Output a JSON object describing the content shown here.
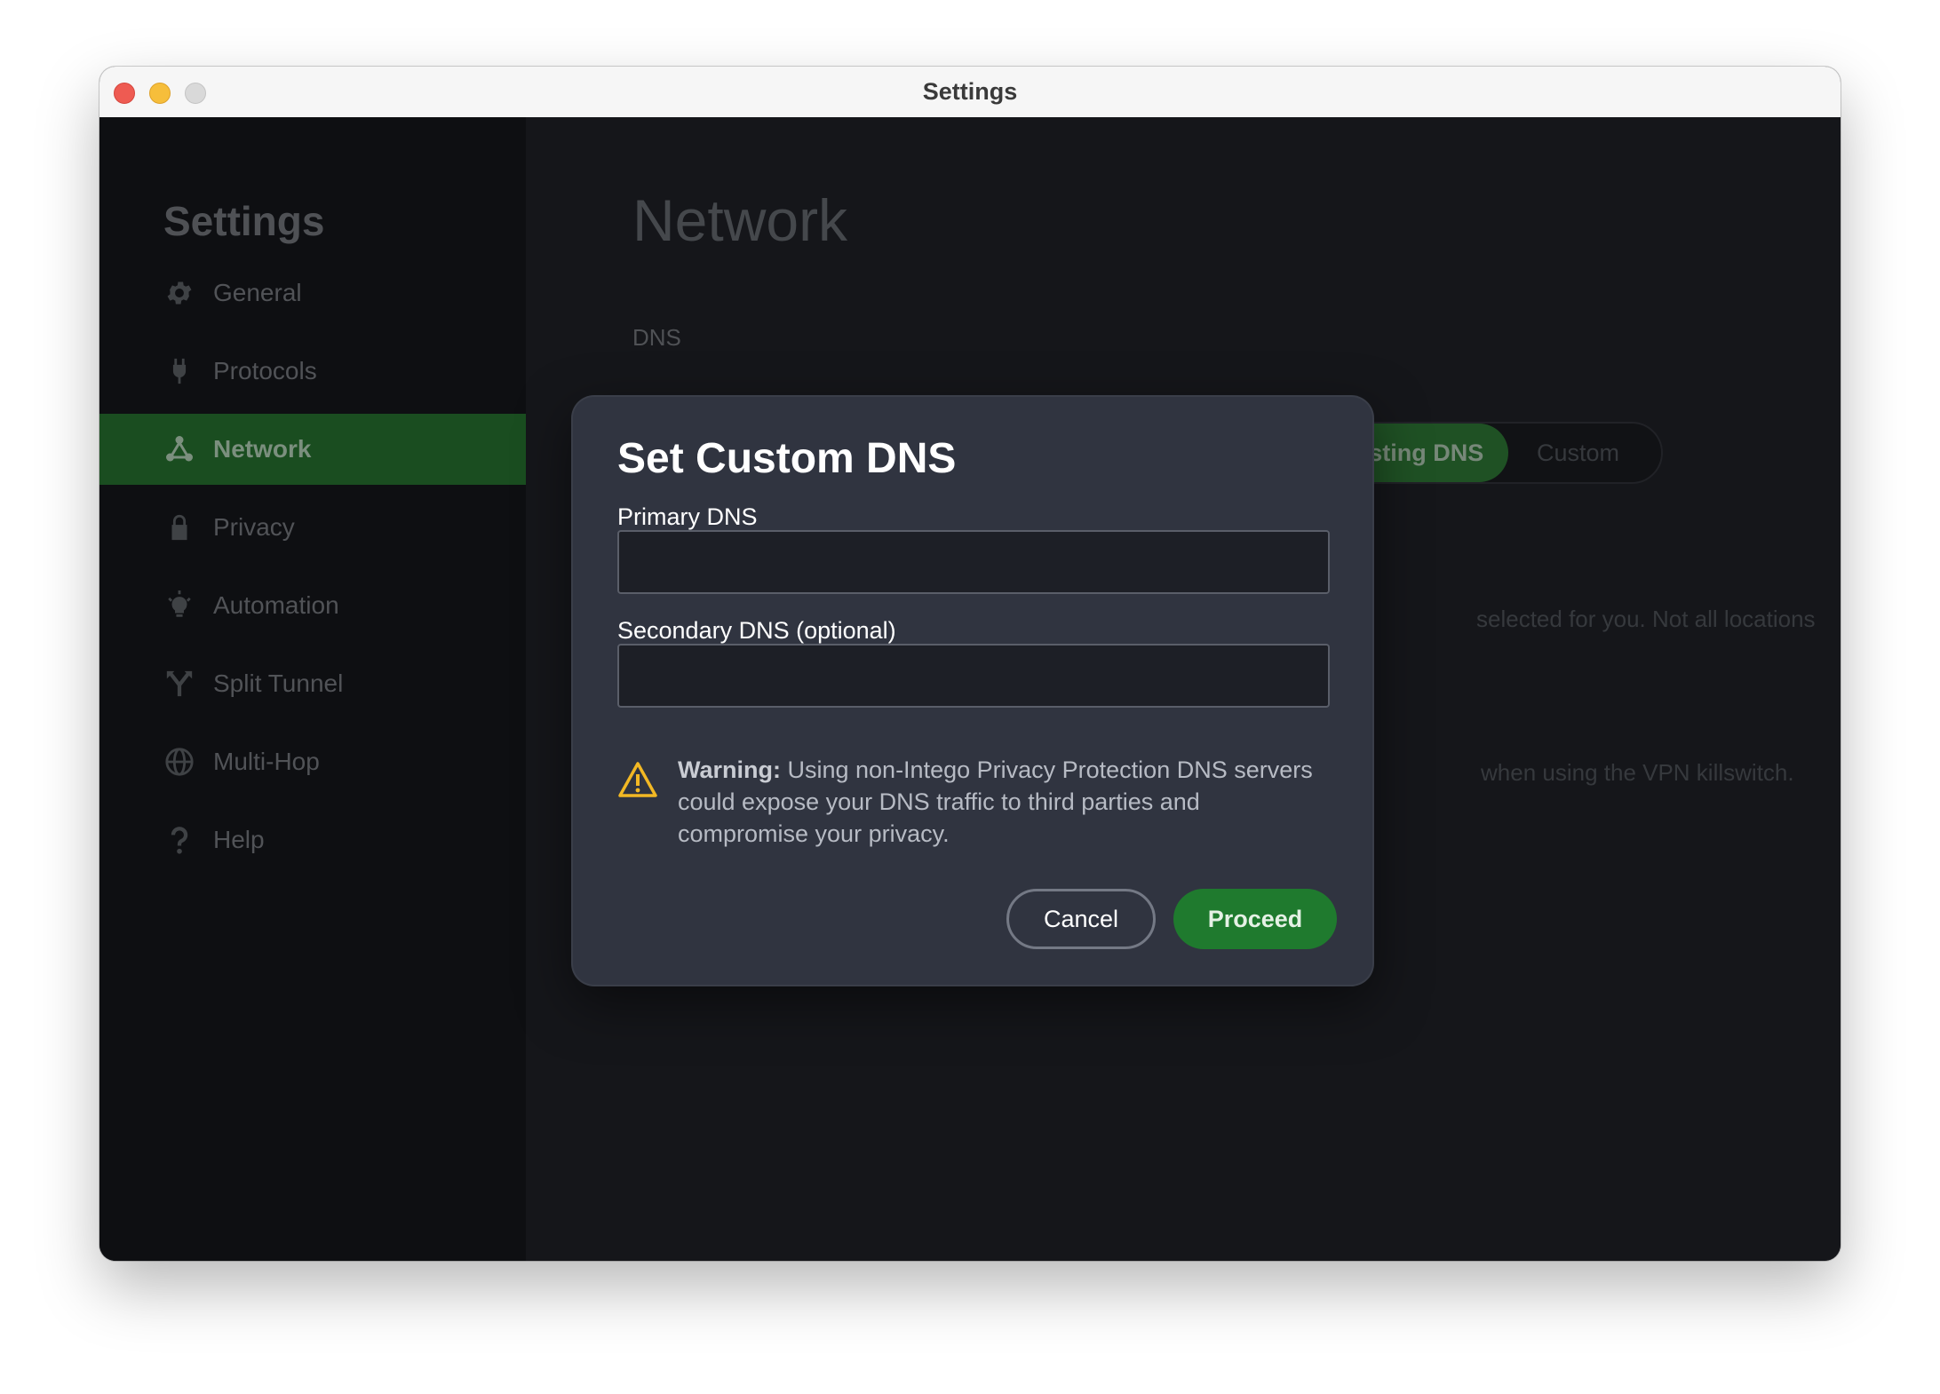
{
  "window": {
    "title": "Settings"
  },
  "sidebar": {
    "heading": "Settings",
    "items": [
      {
        "label": "General",
        "icon": "gear-icon"
      },
      {
        "label": "Protocols",
        "icon": "plug-icon"
      },
      {
        "label": "Network",
        "icon": "network-icon",
        "active": true
      },
      {
        "label": "Privacy",
        "icon": "lock-icon"
      },
      {
        "label": "Automation",
        "icon": "lightbulb-icon"
      },
      {
        "label": "Split Tunnel",
        "icon": "split-icon"
      },
      {
        "label": "Multi-Hop",
        "icon": "globe-icon"
      },
      {
        "label": "Help",
        "icon": "question-icon"
      }
    ]
  },
  "main": {
    "title": "Network",
    "dns_label": "DNS",
    "dns_options": [
      {
        "label": "Use Existing DNS",
        "selected": true
      },
      {
        "label": "Custom"
      }
    ],
    "bg_line1": "selected for you. Not all locations",
    "bg_line2": "when using the VPN killswitch."
  },
  "modal": {
    "title": "Set Custom DNS",
    "primary_label": "Primary DNS",
    "primary_value": "",
    "secondary_label": "Secondary DNS (optional)",
    "secondary_value": "",
    "warning_strong": "Warning:",
    "warning_text": " Using non-Intego Privacy Protection DNS servers could expose your DNS traffic to third parties and compromise your privacy.",
    "cancel_label": "Cancel",
    "proceed_label": "Proceed"
  },
  "colors": {
    "accent_green": "#23672b",
    "proceed_green": "#1f7a2e",
    "warning_yellow": "#f2b824",
    "sidebar_bg": "#131419",
    "main_bg": "#1c1e23",
    "modal_bg": "#303440"
  }
}
